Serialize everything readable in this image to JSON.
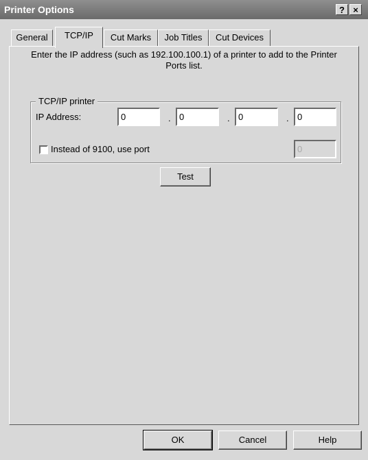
{
  "window": {
    "title": "Printer Options",
    "help_glyph": "?",
    "close_glyph": "×"
  },
  "tabs": [
    {
      "label": "General",
      "active": false
    },
    {
      "label": "TCP/IP",
      "active": true
    },
    {
      "label": "Cut Marks",
      "active": false
    },
    {
      "label": "Job Titles",
      "active": false
    },
    {
      "label": "Cut Devices",
      "active": false
    }
  ],
  "instructions": "Enter the IP address (such as 192.100.100.1) of a printer to add to the Printer Ports list.",
  "group": {
    "title": "TCP/IP printer",
    "ip_label": "IP Address:",
    "ip_octets": [
      "0",
      "0",
      "0",
      "0"
    ],
    "separator": ".",
    "port_checkbox_label": "Instead of 9100, use port",
    "port_checked": false,
    "port_value": "0"
  },
  "buttons": {
    "test": "Test",
    "ok": "OK",
    "cancel": "Cancel",
    "help": "Help"
  }
}
